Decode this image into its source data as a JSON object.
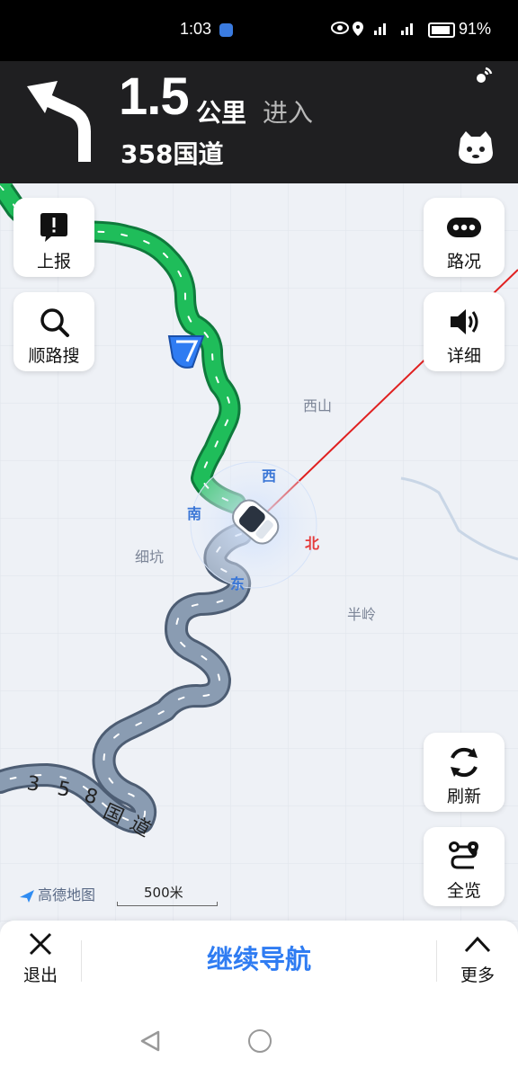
{
  "status_bar": {
    "time": "1:03",
    "indicators": "4G 4G",
    "battery_percent": "91%"
  },
  "nav": {
    "maneuver_icon": "turn-left-arrow",
    "distance": "1.5",
    "distance_unit": "公里",
    "action": "进入",
    "road_name": "358国道"
  },
  "left_buttons": [
    {
      "label": "上报",
      "icon": "report-icon"
    },
    {
      "label": "顺路搜",
      "icon": "search-icon"
    }
  ],
  "right_buttons_top": [
    {
      "label": "路况",
      "icon": "traffic-dots-icon"
    },
    {
      "label": "详细",
      "icon": "speaker-icon"
    }
  ],
  "right_buttons_bottom": [
    {
      "label": "刷新",
      "icon": "refresh-icon"
    },
    {
      "label": "全览",
      "icon": "route-overview-icon"
    }
  ],
  "map": {
    "labels": [
      "西山",
      "细坑",
      "半岭"
    ],
    "compass": {
      "west": "西",
      "south": "南",
      "north": "北",
      "east": "东"
    },
    "road_label_chars": [
      "3",
      "5",
      "8",
      "国",
      "道"
    ],
    "logo_text": "高德地图",
    "scale_label": "500米",
    "colors": {
      "route_passed": "#1fbd5a",
      "route_ahead": "#8a9cb2",
      "heading_line": "#e02020",
      "accent": "#2f7cf2"
    }
  },
  "bottom_bar": {
    "exit_label": "退出",
    "continue_label": "继续导航",
    "more_label": "更多"
  }
}
